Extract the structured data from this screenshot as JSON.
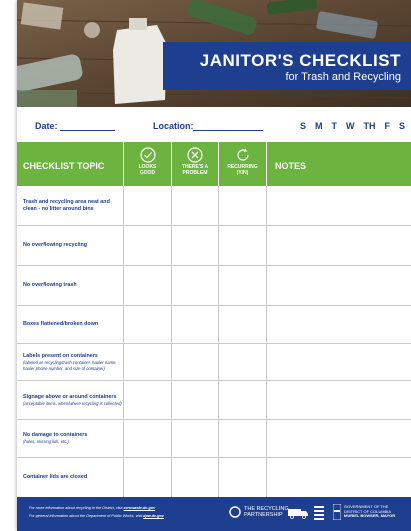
{
  "title": {
    "main": "JANITOR'S CHECKLIST",
    "sub": "for Trash and Recycling"
  },
  "info": {
    "date_label": "Date:",
    "location_label": "Location:",
    "days": [
      "S",
      "M",
      "T",
      "W",
      "TH",
      "F",
      "S"
    ]
  },
  "table": {
    "headers": {
      "topic": "CHECKLIST TOPIC",
      "looks_good": [
        "LOOKS",
        "GOOD"
      ],
      "problem": [
        "THERE'S A",
        "PROBLEM"
      ],
      "recurring": [
        "RECURRING",
        "(Y/N)"
      ],
      "notes": "NOTES"
    },
    "rows": [
      {
        "text": "Trash and recycling area neat and clean - no litter around bins",
        "note": ""
      },
      {
        "text": "No overflowing recycling",
        "note": ""
      },
      {
        "text": "No overflowing trash",
        "note": ""
      },
      {
        "text": "Boxes flattened/broken down",
        "note": ""
      },
      {
        "text": "Labels present on containers",
        "note": "(labeled as recycling/trash container, hauler name, hauler phone number, and size of container)"
      },
      {
        "text": "Signage above or around containers",
        "note": "(acceptable items, when/where recycling is collected)"
      },
      {
        "text": "No damage to containers",
        "note": "(holes, missing lids, etc.)"
      },
      {
        "text": "Container lids are closed",
        "note": ""
      }
    ]
  },
  "footer": {
    "line1_prefix": "For more information about recycling in the District, visit ",
    "line1_link": "zerowaste.dc.gov",
    "line2_prefix": "For general information about the Department of Public Works, visit ",
    "line2_link": "dpw.dc.gov",
    "partner": [
      "THE RECYCLING",
      "PARTNERSHIP"
    ],
    "dc_gov": [
      "GOVERNMENT OF THE",
      "DISTRICT OF COLUMBIA",
      "MURIEL BOWSER, MAYOR"
    ]
  },
  "colors": {
    "brand_blue": "#1e3f8f",
    "header_green": "#6cb33f"
  }
}
